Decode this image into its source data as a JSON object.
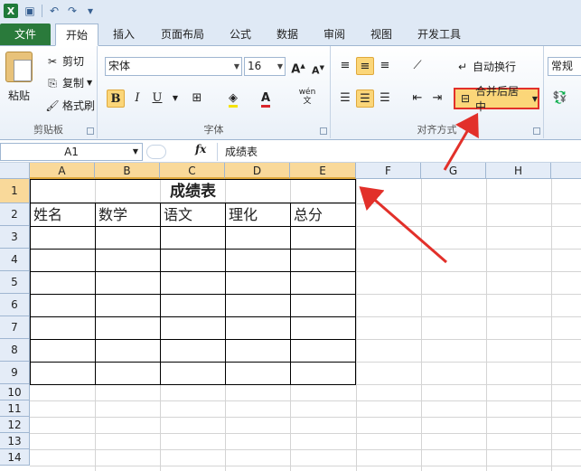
{
  "qat": {
    "icons": [
      "excel-logo-icon",
      "save-icon",
      "undo-icon",
      "redo-icon",
      "customize-icon"
    ],
    "logo_letter": "X"
  },
  "tabs": [
    {
      "label": "文件"
    },
    {
      "label": "开始"
    },
    {
      "label": "插入"
    },
    {
      "label": "页面布局"
    },
    {
      "label": "公式"
    },
    {
      "label": "数据"
    },
    {
      "label": "审阅"
    },
    {
      "label": "视图"
    },
    {
      "label": "开发工具"
    }
  ],
  "clipboard": {
    "paste": "粘贴",
    "cut": "剪切",
    "copy": "复制",
    "format_painter": "格式刷",
    "label": "剪贴板"
  },
  "font": {
    "name": "宋体",
    "size": "16",
    "label": "字体",
    "grow": "A",
    "shrink": "A",
    "bold": "B",
    "italic": "I",
    "underline": "U",
    "font_color": "A",
    "phonetic": "wén"
  },
  "alignment": {
    "wrap": "自动换行",
    "merge": "合并后居中",
    "label": "对齐方式"
  },
  "number": {
    "format": "常规"
  },
  "formula_bar": {
    "name_box": "A1",
    "fx": "fx",
    "content": "成绩表"
  },
  "sheet": {
    "columns": [
      "A",
      "B",
      "C",
      "D",
      "E",
      "F",
      "G",
      "H"
    ],
    "rows": [
      "1",
      "2",
      "3",
      "4",
      "5",
      "6",
      "7",
      "8",
      "9",
      "10",
      "11",
      "12",
      "13",
      "14"
    ],
    "title": "成绩表",
    "headers": [
      "姓名",
      "数学",
      "语文",
      "理化",
      "总分"
    ]
  },
  "colors": {
    "accent": "#fbd679",
    "highlight": "#e2302a",
    "file_tab": "#2a7a3b"
  }
}
